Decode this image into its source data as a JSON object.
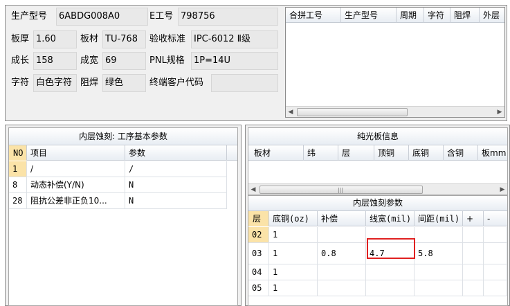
{
  "header_form": {
    "model_label": "生产型号",
    "model_value": "6ABDG008A0",
    "eno_label": "E工号",
    "eno_value": "798756",
    "thickness_label": "板厚",
    "thickness_value": "1.60",
    "material_label": "板材",
    "material_value": "TU-768",
    "standard_label": "验收标准",
    "standard_value": "IPC-6012 Ⅱ级",
    "length_label": "成长",
    "length_value": "158",
    "width_label": "成宽",
    "width_value": "69",
    "pnl_label": "PNL规格",
    "pnl_value": "1P=14U",
    "char_label": "字符",
    "char_value": "白色字符",
    "mask_label": "阻焊",
    "mask_value": "绿色",
    "customer_label": "终端客户代码",
    "customer_value": ""
  },
  "combined_grid": {
    "columns": [
      "合拼工号",
      "生产型号",
      "周期",
      "字符",
      "阻焊",
      "外层"
    ]
  },
  "process_panel": {
    "title": "内层蚀刻: 工序基本参数",
    "columns": [
      "NO",
      "项目",
      "参数"
    ],
    "rows": [
      {
        "no": "1",
        "item": "/",
        "param": "/"
      },
      {
        "no": "8",
        "item": "动态补偿(Y/N)",
        "param": "N"
      },
      {
        "no": "28",
        "item": "阻抗公差非正负10...",
        "param": "N"
      }
    ]
  },
  "bare_board": {
    "title": "纯光板信息",
    "columns": [
      "板材",
      "纬",
      "层",
      "顶铜",
      "底铜",
      "含铜",
      "板mm"
    ]
  },
  "etch_params": {
    "title": "内层蚀刻参数",
    "columns": [
      "层",
      "底铜(oz)",
      "补偿",
      "线宽(mil)",
      "间距(mil)",
      "+",
      "-"
    ],
    "rows": [
      {
        "layer": "02",
        "base": "1",
        "comp": "",
        "width": "",
        "gap": "",
        "plus": "",
        "minus": ""
      },
      {
        "layer": "03",
        "base": "1",
        "comp": "0.8",
        "width": "4.7",
        "gap": "5.8",
        "plus": "",
        "minus": ""
      },
      {
        "layer": "04",
        "base": "1",
        "comp": "",
        "width": "",
        "gap": "",
        "plus": "",
        "minus": ""
      },
      {
        "layer": "05",
        "base": "1",
        "comp": "",
        "width": "",
        "gap": "",
        "plus": "",
        "minus": ""
      }
    ]
  },
  "scroll_icons": {
    "left": "arrow-left-icon",
    "right": "arrow-right-icon",
    "grip": "grip-icon"
  }
}
